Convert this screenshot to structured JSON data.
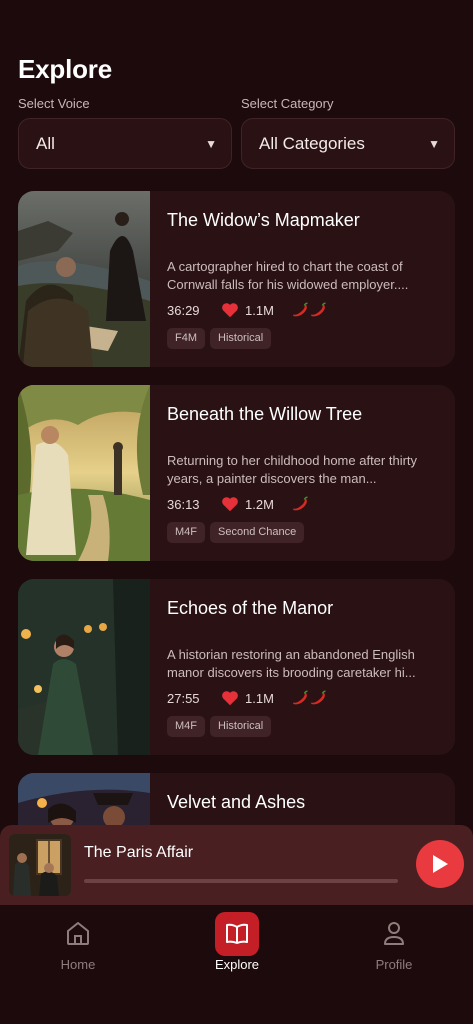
{
  "header": {
    "title": "Explore"
  },
  "filters": {
    "voice": {
      "label": "Select Voice",
      "value": "All"
    },
    "category": {
      "label": "Select Category",
      "value": "All Categories"
    }
  },
  "stories": [
    {
      "title": "The Widow’s Mapmaker",
      "description": "A cartographer hired to chart the coast of Cornwall falls for his widowed employer....",
      "duration": "36:29",
      "likes": "1.1M",
      "spice": 2,
      "tags": [
        "F4M",
        "Historical"
      ]
    },
    {
      "title": "Beneath the Willow Tree",
      "description": "Returning to her childhood home after thirty years, a painter discovers the man...",
      "duration": "36:13",
      "likes": "1.2M",
      "spice": 1,
      "tags": [
        "M4F",
        "Second Chance"
      ]
    },
    {
      "title": "Echoes of the Manor",
      "description": "A historian restoring an abandoned English manor discovers its brooding caretaker hi...",
      "duration": "27:55",
      "likes": "1.1M",
      "spice": 2,
      "tags": [
        "M4F",
        "Historical"
      ]
    },
    {
      "title": "Velvet and Ashes"
    }
  ],
  "player": {
    "title": "The Paris Affair",
    "progress": 0.0
  },
  "tabs": [
    {
      "label": "Home",
      "icon": "home-icon",
      "active": false
    },
    {
      "label": "Explore",
      "icon": "book-icon",
      "active": true
    },
    {
      "label": "Profile",
      "icon": "person-icon",
      "active": false
    }
  ],
  "colors": {
    "accent": "#e93a40",
    "background": "#1d0a0c",
    "card": "#2a1214"
  }
}
